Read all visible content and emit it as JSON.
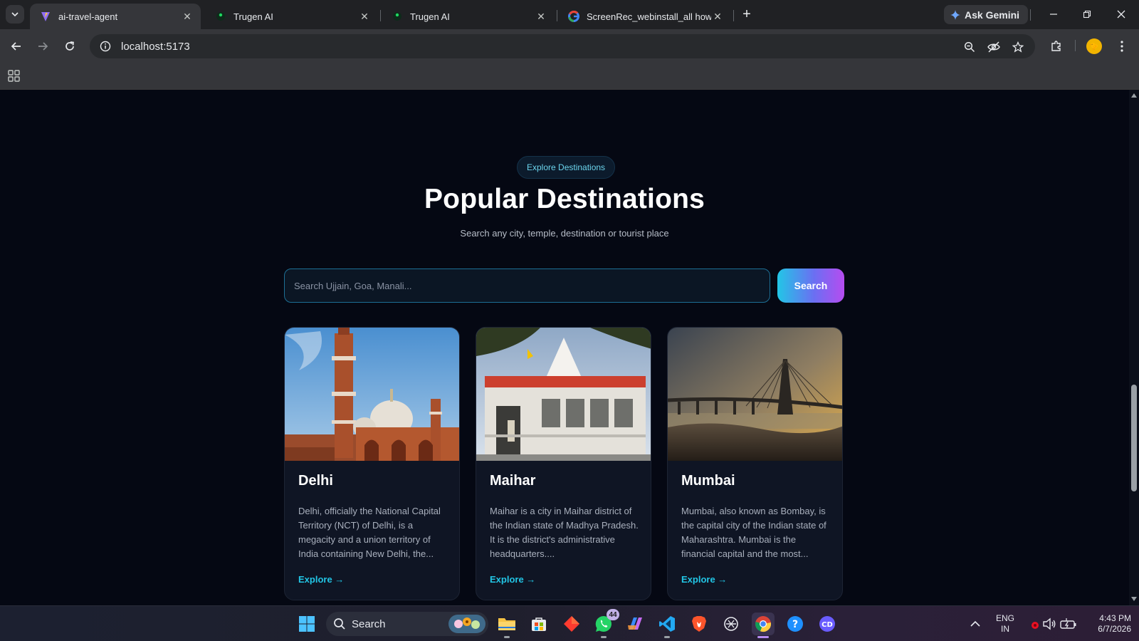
{
  "browser": {
    "tabs": [
      {
        "title": "ai-travel-agent",
        "icon": "vite-icon",
        "active": true
      },
      {
        "title": "Trugen AI",
        "icon": "trugen-icon",
        "active": false
      },
      {
        "title": "Trugen AI",
        "icon": "trugen-icon",
        "active": false
      },
      {
        "title": "ScreenRec_webinstall_all how to",
        "icon": "google-icon",
        "active": false
      }
    ],
    "ask_gemini_label": "Ask Gemini",
    "url": "localhost:5173"
  },
  "page": {
    "pill_label": "Explore Destinations",
    "heading": "Popular Destinations",
    "subheading": "Search any city, temple, destination or tourist place",
    "search": {
      "placeholder": "Search Ujjain, Goa, Manali...",
      "value": "",
      "button_label": "Search"
    },
    "cards": [
      {
        "name": "Delhi",
        "description": "Delhi, officially the National Capital Territory (NCT) of Delhi, is a megacity and a union territory of India containing New Delhi, the...",
        "link_label": "Explore →",
        "image": "jama-masjid-photo"
      },
      {
        "name": "Maihar",
        "description": "Maihar is a city in Maihar district of the Indian state of Madhya Pradesh. It is the district's administrative headquarters....",
        "link_label": "Explore →",
        "image": "maihar-temple-photo"
      },
      {
        "name": "Mumbai",
        "description": "Mumbai, also known as Bombay, is the capital city of the Indian state of Maharashtra. Mumbai is the financial capital and the most...",
        "link_label": "Explore →",
        "image": "bandra-worli-sea-link-photo"
      }
    ]
  },
  "taskbar": {
    "search_label": "Search",
    "whatsapp_badge": "44",
    "language": "ENG",
    "region": "IN",
    "time": "4:43 PM",
    "date": "6/7/2026"
  },
  "colors": {
    "page_bg": "#050813",
    "card_bg": "#0f1524",
    "accent_cyan": "#22c6e6",
    "accent_purple": "#b64cf0"
  }
}
